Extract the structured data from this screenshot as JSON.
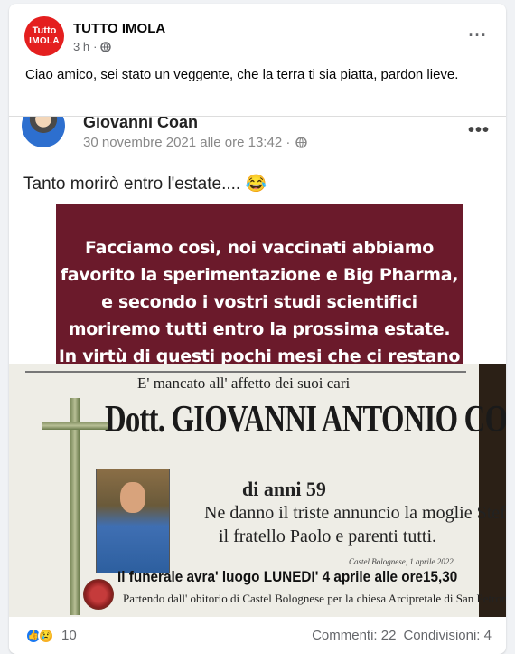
{
  "post": {
    "page_name": "TUTTO IMOLA",
    "avatar_text_1": "Tutto",
    "avatar_text_2": "IMOLA",
    "time": "3 h",
    "more": "···",
    "caption": "Ciao amico, sei stato un veggente, che la terra ti sia piatta, pardon lieve."
  },
  "embedded": {
    "author": "Giovanni Coan",
    "date": "30 novembre 2021 alle ore 13:42 ·",
    "text": "Tanto morirò entro l'estate.... 😂",
    "quote_lines": [
      "Facciamo così, noi vaccinati abbiamo",
      "favorito la sperimentazione e Big Pharma,",
      "e secondo i vostri studi scientifici",
      "moriremo tutti entro la prossima estate.",
      "In virtù di questi pochi mesi che ci restano"
    ]
  },
  "notice": {
    "top": "E' mancato all' affetto dei suoi cari",
    "name": "Dott. GIOVANNI ANTONIO COAN",
    "age": "di anni 59",
    "line1": "Ne danno il triste annuncio la moglie Stefania,",
    "line2": "il fratello Paolo  e parenti tutti.",
    "place_date": "Castel Bolognese, 1 aprile 2022",
    "funeral": "Il funerale avra' luogo LUNEDI' 4 aprile alle ore15,30",
    "funeral2": "Partendo dall' obitorio di Castel Bolognese per la chiesa Arcipretale di San Petronio."
  },
  "footer": {
    "reaction_count": "10",
    "comments": "Commenti: 22",
    "shares": "Condivisioni: 4"
  },
  "colors": {
    "brand_red": "#e41f1f",
    "quote_bg": "#6b1a2b",
    "like_blue": "#1877f2",
    "sad_yellow": "#f7b125"
  }
}
